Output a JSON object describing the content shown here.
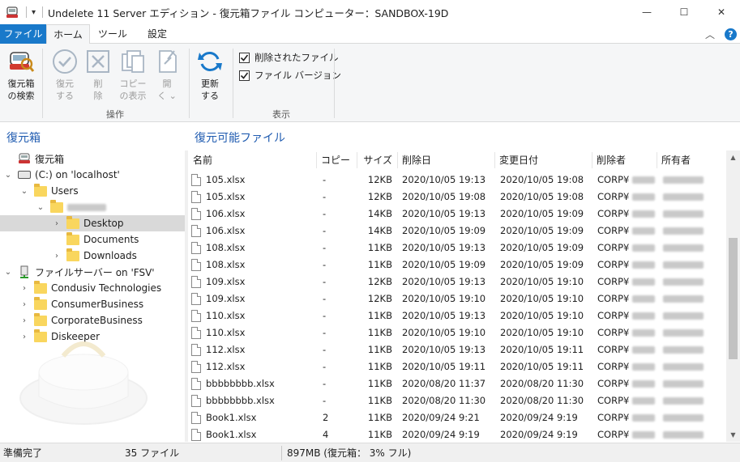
{
  "window": {
    "title": "Undelete 11 Server エディション - 復元箱ファイル コンピューター：SANDBOX-19D",
    "minimize": "—",
    "maximize": "☐",
    "close": "✕"
  },
  "ribbon_tabs": [
    {
      "label": "ファイル"
    },
    {
      "label": "ホーム"
    },
    {
      "label": "ツール"
    },
    {
      "label": "設定"
    }
  ],
  "ribbon_controls": {
    "collapse": "︿",
    "help": "?"
  },
  "ribbon": {
    "search_label": "復元箱\nの検索",
    "ops": [
      {
        "label": "復元\nする",
        "icon": "check-circle-icon"
      },
      {
        "label": "削\n除",
        "icon": "delete-x-icon"
      },
      {
        "label": "コピー\nの表示",
        "icon": "copies-icon"
      },
      {
        "label": "開\nく ⌄",
        "icon": "open-file-icon"
      }
    ],
    "ops_group": "操作",
    "refresh_label": "更新\nする",
    "view_checks": [
      {
        "label": "削除されたファイル",
        "checked": true
      },
      {
        "label": "ファイル バージョン",
        "checked": true
      }
    ],
    "view_group": "表示"
  },
  "left_pane": {
    "title": "復元箱",
    "tree": [
      {
        "label": "復元箱",
        "indent": 0,
        "chevron": "",
        "icon": "recycle-icon"
      },
      {
        "label": "(C:) on 'localhost'",
        "indent": 0,
        "chevron": "⌄",
        "icon": "drive-icon"
      },
      {
        "label": "Users",
        "indent": 1,
        "chevron": "⌄",
        "icon": "folder-icon"
      },
      {
        "label": "",
        "indent": 2,
        "chevron": "⌄",
        "icon": "folder-icon",
        "redacted": true
      },
      {
        "label": "Desktop",
        "indent": 3,
        "chevron": "›",
        "icon": "folder-icon",
        "selected": true
      },
      {
        "label": "Documents",
        "indent": 3,
        "chevron": "",
        "icon": "folder-icon"
      },
      {
        "label": "Downloads",
        "indent": 3,
        "chevron": "›",
        "icon": "folder-icon"
      },
      {
        "label": "ファイルサーバー on 'FSV'",
        "indent": 0,
        "chevron": "⌄",
        "icon": "server-icon"
      },
      {
        "label": "Condusiv Technologies",
        "indent": 1,
        "chevron": "›",
        "icon": "folder-icon"
      },
      {
        "label": "ConsumerBusiness",
        "indent": 1,
        "chevron": "›",
        "icon": "folder-icon"
      },
      {
        "label": "CorporateBusiness",
        "indent": 1,
        "chevron": "›",
        "icon": "folder-icon"
      },
      {
        "label": "Diskeeper",
        "indent": 1,
        "chevron": "›",
        "icon": "folder-icon"
      }
    ]
  },
  "right_pane": {
    "title": "復元可能ファイル",
    "columns": [
      "名前",
      "コピー",
      "サイズ",
      "削除日",
      "変更日付",
      "削除者",
      "所有者"
    ],
    "rows": [
      [
        "105.xlsx",
        "-",
        "12KB",
        "2020/10/05 19:13",
        "2020/10/05 19:08",
        "CORP¥"
      ],
      [
        "105.xlsx",
        "-",
        "12KB",
        "2020/10/05 19:08",
        "2020/10/05 19:08",
        "CORP¥"
      ],
      [
        "106.xlsx",
        "-",
        "14KB",
        "2020/10/05 19:13",
        "2020/10/05 19:09",
        "CORP¥"
      ],
      [
        "106.xlsx",
        "-",
        "14KB",
        "2020/10/05 19:09",
        "2020/10/05 19:09",
        "CORP¥"
      ],
      [
        "108.xlsx",
        "-",
        "11KB",
        "2020/10/05 19:13",
        "2020/10/05 19:09",
        "CORP¥"
      ],
      [
        "108.xlsx",
        "-",
        "11KB",
        "2020/10/05 19:09",
        "2020/10/05 19:09",
        "CORP¥"
      ],
      [
        "109.xlsx",
        "-",
        "12KB",
        "2020/10/05 19:13",
        "2020/10/05 19:10",
        "CORP¥"
      ],
      [
        "109.xlsx",
        "-",
        "12KB",
        "2020/10/05 19:10",
        "2020/10/05 19:10",
        "CORP¥"
      ],
      [
        "110.xlsx",
        "-",
        "11KB",
        "2020/10/05 19:13",
        "2020/10/05 19:10",
        "CORP¥"
      ],
      [
        "110.xlsx",
        "-",
        "11KB",
        "2020/10/05 19:10",
        "2020/10/05 19:10",
        "CORP¥"
      ],
      [
        "112.xlsx",
        "-",
        "11KB",
        "2020/10/05 19:13",
        "2020/10/05 19:11",
        "CORP¥"
      ],
      [
        "112.xlsx",
        "-",
        "11KB",
        "2020/10/05 19:11",
        "2020/10/05 19:11",
        "CORP¥"
      ],
      [
        "bbbbbbbb.xlsx",
        "-",
        "11KB",
        "2020/08/20 11:37",
        "2020/08/20 11:30",
        "CORP¥"
      ],
      [
        "bbbbbbbb.xlsx",
        "-",
        "11KB",
        "2020/08/20 11:30",
        "2020/08/20 11:30",
        "CORP¥"
      ],
      [
        "Book1.xlsx",
        "2",
        "11KB",
        "2020/09/24 9:21",
        "2020/09/24 9:19",
        "CORP¥"
      ],
      [
        "Book1.xlsx",
        "4",
        "11KB",
        "2020/09/24 9:19",
        "2020/09/24 9:19",
        "CORP¥"
      ]
    ]
  },
  "status": {
    "ready": "準備完了",
    "count": "35 ファイル",
    "usage": "897MB (復元箱： 3% フル)"
  }
}
